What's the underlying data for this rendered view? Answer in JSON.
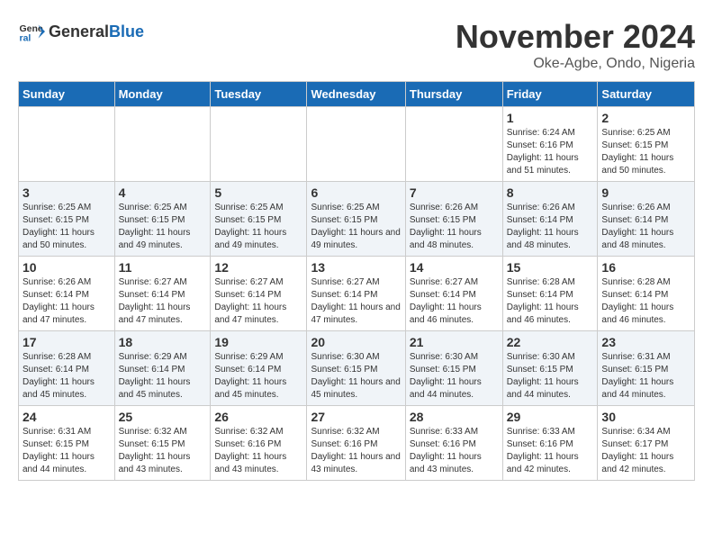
{
  "logo": {
    "text_general": "General",
    "text_blue": "Blue"
  },
  "title": {
    "month": "November 2024",
    "location": "Oke-Agbe, Ondo, Nigeria"
  },
  "weekdays": [
    "Sunday",
    "Monday",
    "Tuesday",
    "Wednesday",
    "Thursday",
    "Friday",
    "Saturday"
  ],
  "weeks": [
    [
      {
        "day": "",
        "info": ""
      },
      {
        "day": "",
        "info": ""
      },
      {
        "day": "",
        "info": ""
      },
      {
        "day": "",
        "info": ""
      },
      {
        "day": "",
        "info": ""
      },
      {
        "day": "1",
        "info": "Sunrise: 6:24 AM\nSunset: 6:16 PM\nDaylight: 11 hours and 51 minutes."
      },
      {
        "day": "2",
        "info": "Sunrise: 6:25 AM\nSunset: 6:15 PM\nDaylight: 11 hours and 50 minutes."
      }
    ],
    [
      {
        "day": "3",
        "info": "Sunrise: 6:25 AM\nSunset: 6:15 PM\nDaylight: 11 hours and 50 minutes."
      },
      {
        "day": "4",
        "info": "Sunrise: 6:25 AM\nSunset: 6:15 PM\nDaylight: 11 hours and 49 minutes."
      },
      {
        "day": "5",
        "info": "Sunrise: 6:25 AM\nSunset: 6:15 PM\nDaylight: 11 hours and 49 minutes."
      },
      {
        "day": "6",
        "info": "Sunrise: 6:25 AM\nSunset: 6:15 PM\nDaylight: 11 hours and 49 minutes."
      },
      {
        "day": "7",
        "info": "Sunrise: 6:26 AM\nSunset: 6:15 PM\nDaylight: 11 hours and 48 minutes."
      },
      {
        "day": "8",
        "info": "Sunrise: 6:26 AM\nSunset: 6:14 PM\nDaylight: 11 hours and 48 minutes."
      },
      {
        "day": "9",
        "info": "Sunrise: 6:26 AM\nSunset: 6:14 PM\nDaylight: 11 hours and 48 minutes."
      }
    ],
    [
      {
        "day": "10",
        "info": "Sunrise: 6:26 AM\nSunset: 6:14 PM\nDaylight: 11 hours and 47 minutes."
      },
      {
        "day": "11",
        "info": "Sunrise: 6:27 AM\nSunset: 6:14 PM\nDaylight: 11 hours and 47 minutes."
      },
      {
        "day": "12",
        "info": "Sunrise: 6:27 AM\nSunset: 6:14 PM\nDaylight: 11 hours and 47 minutes."
      },
      {
        "day": "13",
        "info": "Sunrise: 6:27 AM\nSunset: 6:14 PM\nDaylight: 11 hours and 47 minutes."
      },
      {
        "day": "14",
        "info": "Sunrise: 6:27 AM\nSunset: 6:14 PM\nDaylight: 11 hours and 46 minutes."
      },
      {
        "day": "15",
        "info": "Sunrise: 6:28 AM\nSunset: 6:14 PM\nDaylight: 11 hours and 46 minutes."
      },
      {
        "day": "16",
        "info": "Sunrise: 6:28 AM\nSunset: 6:14 PM\nDaylight: 11 hours and 46 minutes."
      }
    ],
    [
      {
        "day": "17",
        "info": "Sunrise: 6:28 AM\nSunset: 6:14 PM\nDaylight: 11 hours and 45 minutes."
      },
      {
        "day": "18",
        "info": "Sunrise: 6:29 AM\nSunset: 6:14 PM\nDaylight: 11 hours and 45 minutes."
      },
      {
        "day": "19",
        "info": "Sunrise: 6:29 AM\nSunset: 6:14 PM\nDaylight: 11 hours and 45 minutes."
      },
      {
        "day": "20",
        "info": "Sunrise: 6:30 AM\nSunset: 6:15 PM\nDaylight: 11 hours and 45 minutes."
      },
      {
        "day": "21",
        "info": "Sunrise: 6:30 AM\nSunset: 6:15 PM\nDaylight: 11 hours and 44 minutes."
      },
      {
        "day": "22",
        "info": "Sunrise: 6:30 AM\nSunset: 6:15 PM\nDaylight: 11 hours and 44 minutes."
      },
      {
        "day": "23",
        "info": "Sunrise: 6:31 AM\nSunset: 6:15 PM\nDaylight: 11 hours and 44 minutes."
      }
    ],
    [
      {
        "day": "24",
        "info": "Sunrise: 6:31 AM\nSunset: 6:15 PM\nDaylight: 11 hours and 44 minutes."
      },
      {
        "day": "25",
        "info": "Sunrise: 6:32 AM\nSunset: 6:15 PM\nDaylight: 11 hours and 43 minutes."
      },
      {
        "day": "26",
        "info": "Sunrise: 6:32 AM\nSunset: 6:16 PM\nDaylight: 11 hours and 43 minutes."
      },
      {
        "day": "27",
        "info": "Sunrise: 6:32 AM\nSunset: 6:16 PM\nDaylight: 11 hours and 43 minutes."
      },
      {
        "day": "28",
        "info": "Sunrise: 6:33 AM\nSunset: 6:16 PM\nDaylight: 11 hours and 43 minutes."
      },
      {
        "day": "29",
        "info": "Sunrise: 6:33 AM\nSunset: 6:16 PM\nDaylight: 11 hours and 42 minutes."
      },
      {
        "day": "30",
        "info": "Sunrise: 6:34 AM\nSunset: 6:17 PM\nDaylight: 11 hours and 42 minutes."
      }
    ]
  ]
}
